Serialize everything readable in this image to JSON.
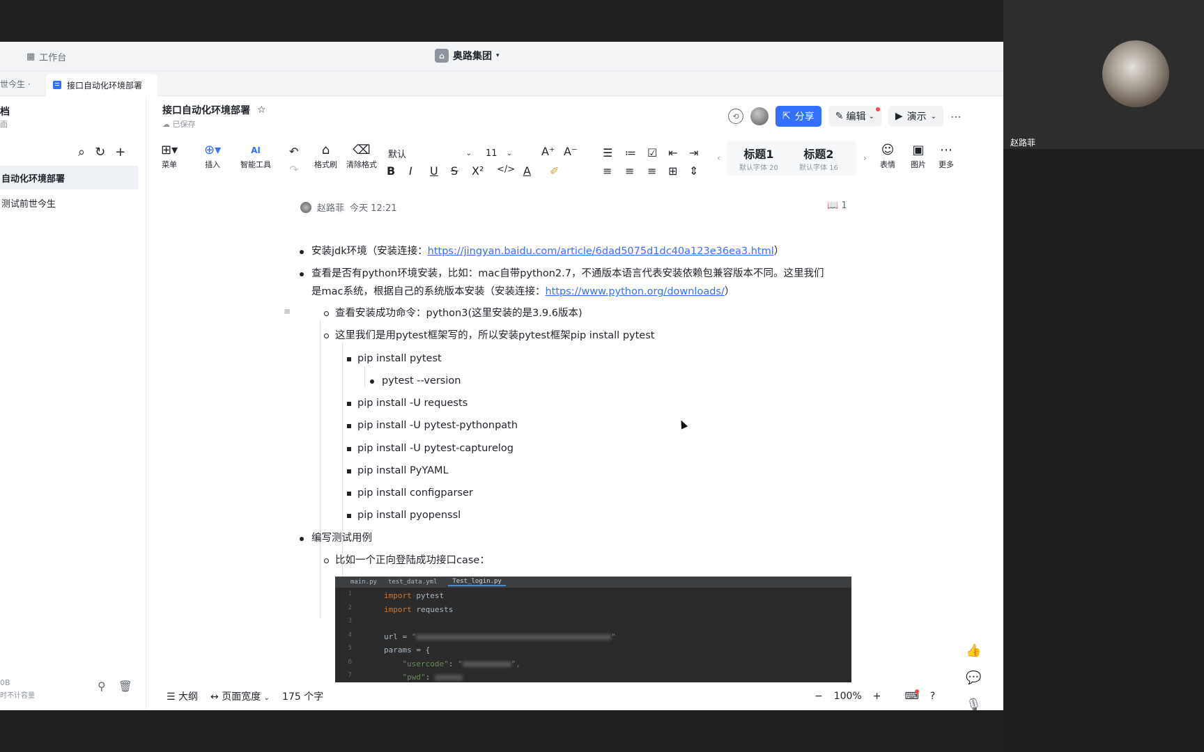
{
  "topbar": {
    "workspace_label": "工作台",
    "org_name": "奥路集团"
  },
  "tabs": {
    "previous_tab": "世今生 ·",
    "active_tab": "接口自动化环境部署"
  },
  "sidebar": {
    "title": "档",
    "subtitle": "面",
    "items": [
      {
        "label": "自动化环境部署",
        "active": true
      },
      {
        "label": "测试前世今生",
        "active": false
      }
    ],
    "footer_size": "0B",
    "footer_note": "时不计容量"
  },
  "doc": {
    "title": "接口自动化环境部署",
    "save_status": "已保存",
    "share_label": "分享",
    "edit_label": "编辑",
    "present_label": "演示"
  },
  "toolbar": {
    "menu_label": "菜单",
    "insert_label": "插入",
    "ai_label": "智能工具",
    "ai_badge": "AI",
    "format_painter_label": "格式刷",
    "clear_format_label": "清除格式",
    "font_family": "默认",
    "font_size": "11",
    "heading1": "标题1",
    "heading1_sub": "默认字体 20",
    "heading2": "标题2",
    "heading2_sub": "默认字体 16",
    "emoji_label": "表情",
    "image_label": "图片",
    "more_label": "更多"
  },
  "meta": {
    "author": "赵路菲",
    "time": "今天 12:21",
    "read_count": "1"
  },
  "content": {
    "l1_prefix": "安装jdk环境（安装连接：",
    "l1_link": "https://jingyan.baidu.com/article/6dad5075d1dc40a123e36ea3.html",
    "l1_suffix": "）",
    "l2_line1": "查看是否有python环境安装，比如：mac自带python2.7，不通版本语言代表安装依赖包兼容版本不同。这里我们",
    "l2_line2_prefix": "是mac系统，根据自己的系统版本安装（安装连接：",
    "l2_link": "https://www.python.org/downloads/",
    "l2_suffix": "）",
    "sub1": "查看安装成功命令：python3(这里安装的是3.9.6版本)",
    "sub2": "这里我们是用pytest框架写的，所以安装pytest框架pip install pytest",
    "pip1": "pip install pytest",
    "pip1_sub": "pytest --version",
    "pip2": "pip install -U requests",
    "pip3": "pip install -U pytest-pythonpath",
    "pip4": "pip install -U pytest-capturelog",
    "pip5": "pip install PyYAML",
    "pip6": "pip install configparser",
    "pip7": "pip install pyopenssl",
    "l3": "编写测试用例",
    "l3_sub": "比如一个正向登陆成功接口case："
  },
  "code_image": {
    "tabs": [
      "main.py",
      "test_data.yml",
      "Test_login.py"
    ],
    "line_numbers": [
      "1",
      "2",
      "3",
      "4",
      "5",
      "6",
      "7"
    ],
    "kw_import": "import",
    "mod_pytest": "pytest",
    "mod_requests": "requests",
    "url_prefix": "url = ",
    "params_line": "params = {",
    "usercode_key": "\"usercode\"",
    "pwd_key": "\"pwd\""
  },
  "statusbar": {
    "outline_label": "大纲",
    "page_width_label": "页面宽度",
    "word_count": "175 个字",
    "zoom": "100%"
  },
  "video": {
    "participant_name": "赵路菲"
  }
}
